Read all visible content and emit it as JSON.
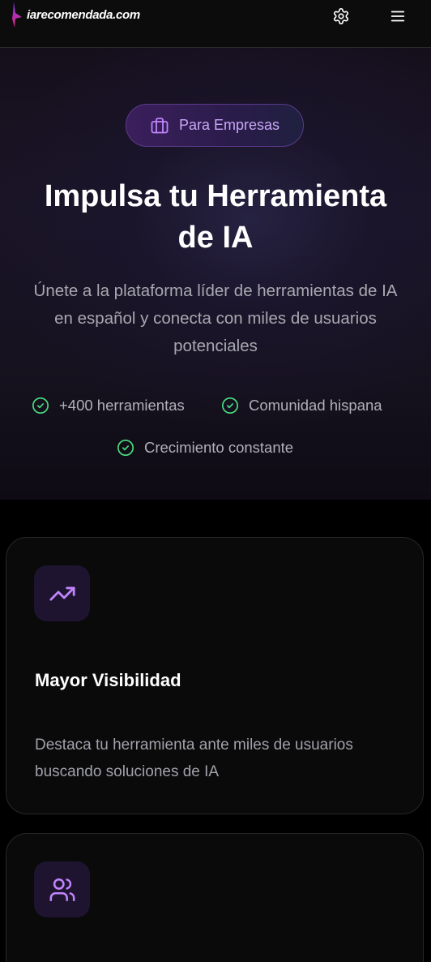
{
  "header": {
    "logo_text": "iarecomendada.com",
    "icons": [
      "settings-gear-icon",
      "hamburger-menu-icon"
    ]
  },
  "hero": {
    "badge": {
      "icon": "briefcase-icon",
      "label": "Para Empresas"
    },
    "title_line1": "Impulsa tu Herramienta",
    "title_line2": "de IA",
    "subtitle_line1": "Únete a la plataforma líder de herramientas de IA",
    "subtitle_line2": "en español y conecta con miles de usuarios",
    "subtitle_line3": "potenciales",
    "features": [
      {
        "icon": "check-circle-icon",
        "label": "+400 herramientas"
      },
      {
        "icon": "check-circle-icon",
        "label": "Comunidad hispana"
      },
      {
        "icon": "check-circle-icon",
        "label": "Crecimiento constante"
      }
    ]
  },
  "cards": [
    {
      "icon": "trending-up-icon",
      "title": "Mayor Visibilidad",
      "description_line1": "Destaca tu herramienta ante miles de usuarios",
      "description_line2": "buscando soluciones de IA"
    },
    {
      "icon": "users-icon"
    }
  ],
  "colors": {
    "accent_purple": "#c084fc",
    "badge_text": "#c9a6f7",
    "check_green": "#4ade80",
    "muted_text": "#a1a1aa",
    "background": "#000000"
  }
}
